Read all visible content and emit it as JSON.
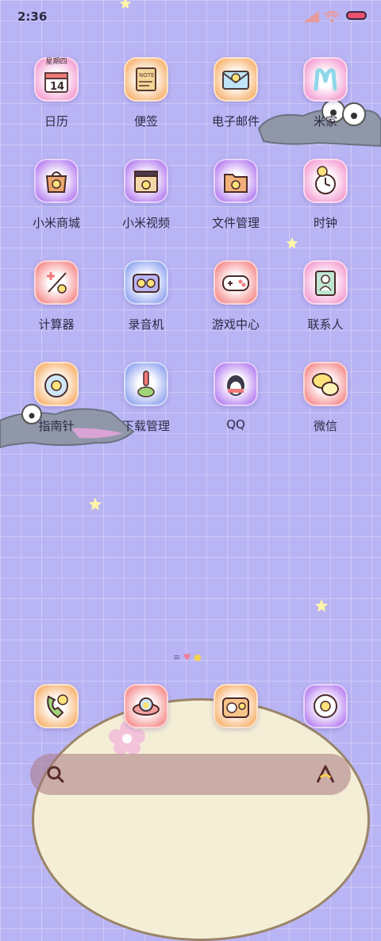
{
  "status_bar": {
    "time": "2:36"
  },
  "apps": [
    {
      "label": "日历",
      "icon": "calendar-icon",
      "badge_text": "星期四",
      "day": "14"
    },
    {
      "label": "便签",
      "icon": "notes-icon",
      "note_text": "NOTE"
    },
    {
      "label": "电子邮件",
      "icon": "email-icon"
    },
    {
      "label": "米家",
      "icon": "mijia-icon"
    },
    {
      "label": "小米商城",
      "icon": "mi-store-icon"
    },
    {
      "label": "小米视频",
      "icon": "mi-video-icon"
    },
    {
      "label": "文件管理",
      "icon": "file-manager-icon"
    },
    {
      "label": "时钟",
      "icon": "clock-icon"
    },
    {
      "label": "计算器",
      "icon": "calculator-icon"
    },
    {
      "label": "录音机",
      "icon": "recorder-icon"
    },
    {
      "label": "游戏中心",
      "icon": "game-center-icon"
    },
    {
      "label": "联系人",
      "icon": "contacts-icon"
    },
    {
      "label": "指南针",
      "icon": "compass-icon"
    },
    {
      "label": "下载管理",
      "icon": "download-manager-icon"
    },
    {
      "label": "QQ",
      "icon": "qq-icon"
    },
    {
      "label": "微信",
      "icon": "wechat-icon"
    }
  ],
  "dock": [
    {
      "icon": "phone-icon"
    },
    {
      "icon": "messages-icon"
    },
    {
      "icon": "camera-icon"
    },
    {
      "icon": "browser-icon"
    }
  ],
  "search_bar": {
    "left_icon": "search-icon",
    "right_icon": "assistant-icon"
  },
  "colors": {
    "background": "#b9b4f4",
    "croc": "#8f97a8",
    "battery": "#e9516f"
  }
}
